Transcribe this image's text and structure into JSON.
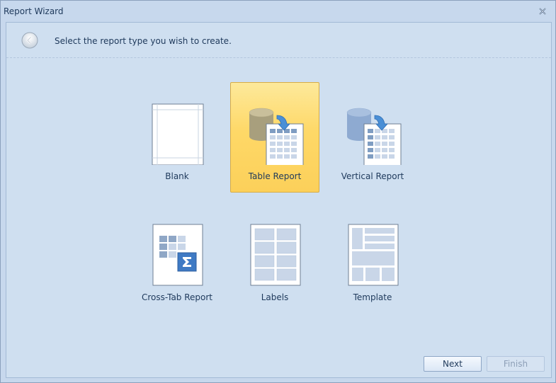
{
  "window": {
    "title": "Report Wizard"
  },
  "header": {
    "instruction": "Select the report type you wish to create."
  },
  "report_types": [
    {
      "label": "Blank",
      "selected": false
    },
    {
      "label": "Table Report",
      "selected": true
    },
    {
      "label": "Vertical Report",
      "selected": false
    },
    {
      "label": "Cross-Tab Report",
      "selected": false
    },
    {
      "label": "Labels",
      "selected": false
    },
    {
      "label": "Template",
      "selected": false
    }
  ],
  "buttons": {
    "next": "Next",
    "finish": "Finish",
    "finish_enabled": false
  },
  "colors": {
    "background": "#c7d8ed",
    "selected_tile": "#fed867",
    "text": "#1e395b",
    "database_selected": "#a89f7d",
    "database_unselected": "#95b0d5",
    "arrow": "#4a8fd6"
  },
  "icons": [
    "close-icon",
    "back-arrow-icon",
    "blank-report-icon",
    "table-report-icon",
    "vertical-report-icon",
    "cross-tab-report-icon",
    "labels-icon",
    "template-icon"
  ]
}
